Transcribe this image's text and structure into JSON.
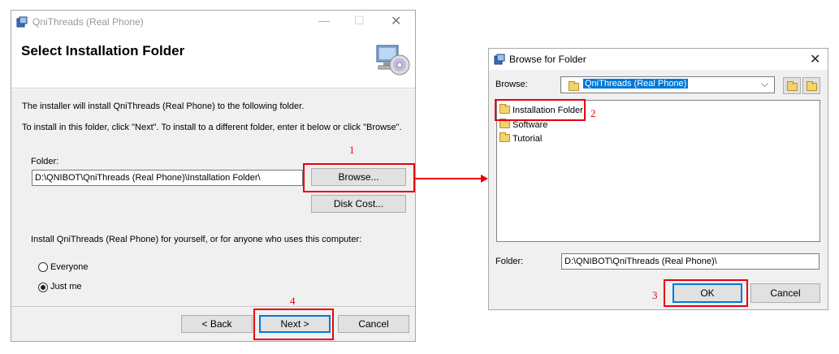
{
  "installer": {
    "title": "QniThreads (Real Phone)",
    "heading": "Select Installation Folder",
    "line1": "The installer will install QniThreads (Real Phone) to the following folder.",
    "line2": "To install in this folder, click \"Next\". To install to a different folder, enter it below or click \"Browse\".",
    "folder_label": "Folder:",
    "folder_value": "D:\\QNIBOT\\QniThreads (Real Phone)\\Installation Folder\\",
    "browse_label": "Browse...",
    "disk_cost_label": "Disk Cost...",
    "install_for_text": "Install QniThreads (Real Phone) for yourself, or for anyone who uses this computer:",
    "radio_everyone": "Everyone",
    "radio_just_me": "Just me",
    "back_label": "< Back",
    "next_label": "Next >",
    "cancel_label": "Cancel"
  },
  "browse_dialog": {
    "title": "Browse for Folder",
    "browse_label": "Browse:",
    "browse_value": "QniThreads (Real Phone)",
    "tree": [
      "Installation Folder",
      "Software",
      "Tutorial"
    ],
    "folder_label": "Folder:",
    "folder_value": "D:\\QNIBOT\\QniThreads (Real Phone)\\",
    "ok_label": "OK",
    "cancel_label": "Cancel"
  },
  "annotations": {
    "n1": "1",
    "n2": "2",
    "n3": "3",
    "n4": "4"
  },
  "colors": {
    "annotation_red": "#e8000f",
    "selection_blue": "#0078d7"
  }
}
